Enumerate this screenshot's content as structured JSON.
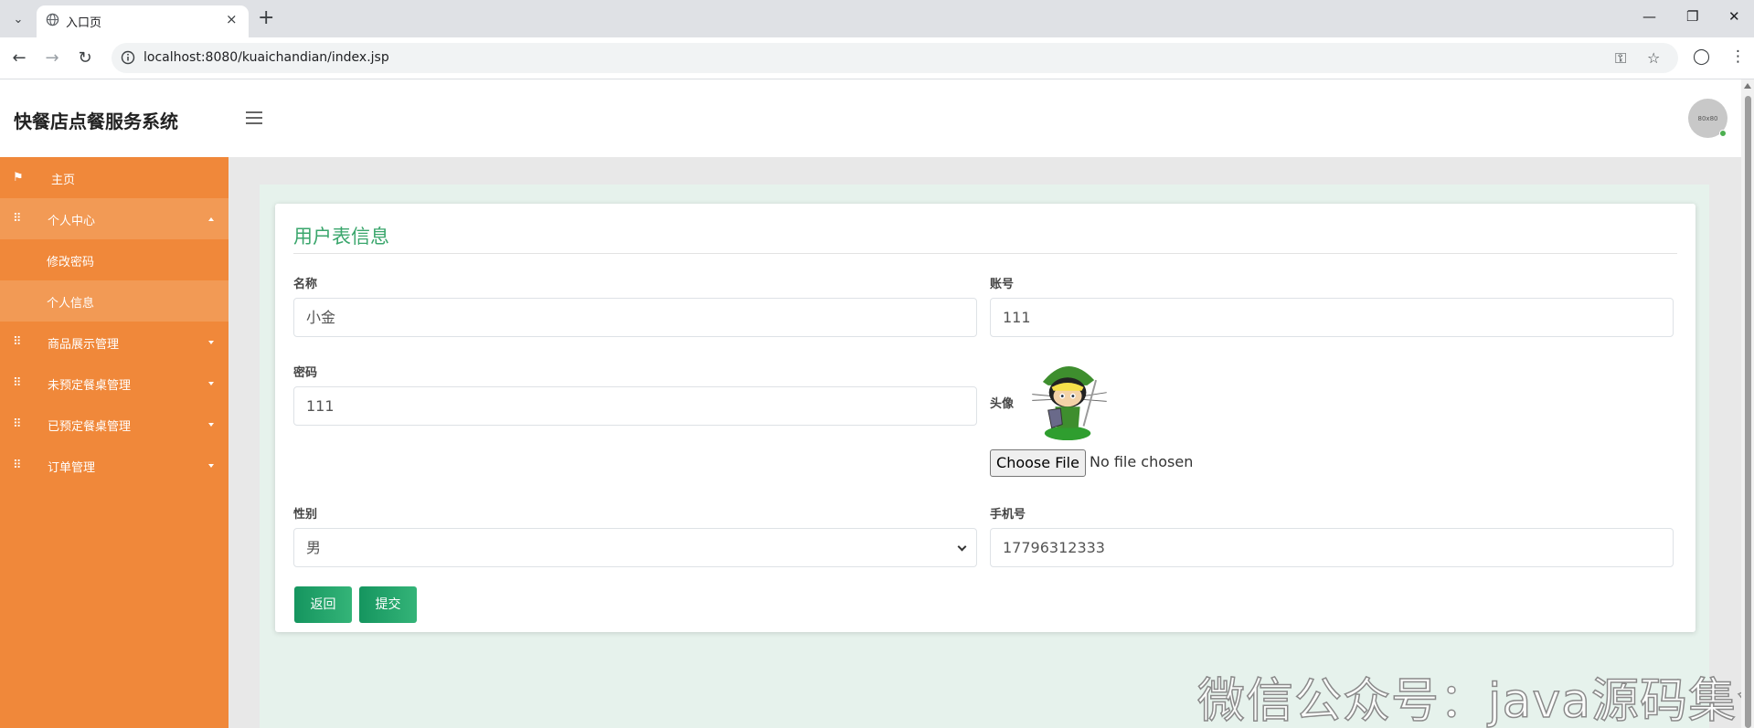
{
  "browser": {
    "tab_title": "入口页",
    "url": "localhost:8080/kuaichandian/index.jsp",
    "new_tab_glyph": "+",
    "close_glyph": "×"
  },
  "app": {
    "title": "快餐店点餐服务系统",
    "avatar_text": "80x80"
  },
  "sidebar": {
    "items": [
      {
        "label": "主页",
        "icon": "flag-icon"
      },
      {
        "label": "个人中心",
        "icon": "grid-icon"
      },
      {
        "label": "修改密码"
      },
      {
        "label": "个人信息"
      },
      {
        "label": "商品展示管理",
        "icon": "grid-icon"
      },
      {
        "label": "未预定餐桌管理",
        "icon": "grid-icon"
      },
      {
        "label": "已预定餐桌管理",
        "icon": "grid-icon"
      },
      {
        "label": "订单管理",
        "icon": "grid-icon"
      }
    ]
  },
  "form": {
    "title": "用户表信息",
    "name_label": "名称",
    "name_value": "小金",
    "account_label": "账号",
    "account_value": "111",
    "password_label": "密码",
    "password_value": "111",
    "avatar_label": "头像",
    "file_button": "Choose File",
    "file_status": "No file chosen",
    "gender_label": "性别",
    "gender_value": "男",
    "phone_label": "手机号",
    "phone_value": "17796312333",
    "back_button": "返回",
    "submit_button": "提交"
  },
  "watermark": "微信公众号：java源码集合",
  "colors": {
    "sidebar": "#f0883a",
    "accent_green": "#3aa66c",
    "button_green": "#15955f"
  }
}
